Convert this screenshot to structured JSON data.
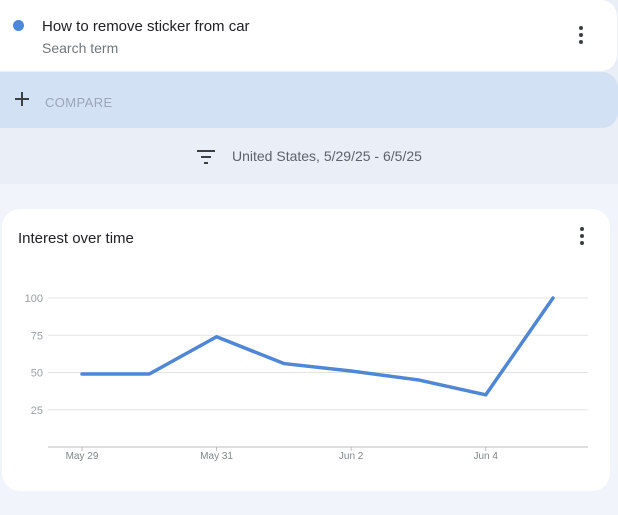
{
  "term": {
    "color": "#4a88dc",
    "title": "How to remove sticker from car",
    "subtitle": "Search term",
    "menu_icon": "more-vert-icon"
  },
  "compare": {
    "icon": "plus-icon",
    "label": "COMPARE"
  },
  "filter": {
    "icon": "filter-icon",
    "text": "United States, 5/29/25 - 6/5/25"
  },
  "chart": {
    "title": "Interest over time",
    "menu_icon": "more-vert-icon"
  },
  "chart_data": {
    "type": "line",
    "title": "Interest over time",
    "xlabel": "",
    "ylabel": "",
    "ylim": [
      0,
      100
    ],
    "yticks": [
      25,
      50,
      75,
      100
    ],
    "grid": true,
    "line_color": "#4f86d6",
    "x": [
      "May 29",
      "May 30",
      "May 31",
      "Jun 1",
      "Jun 2",
      "Jun 3",
      "Jun 4",
      "Jun 5"
    ],
    "x_tick_labels": [
      "May 29",
      "May 31",
      "Jun 2",
      "Jun 4"
    ],
    "series": [
      {
        "values": [
          49,
          49,
          74,
          56,
          51,
          45,
          35,
          100
        ]
      }
    ]
  }
}
